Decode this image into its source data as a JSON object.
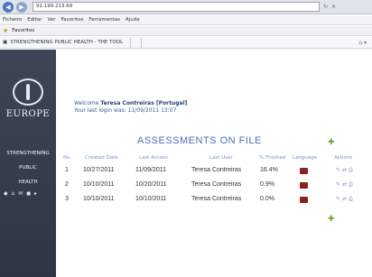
{
  "browser": {
    "address": "91.199.213.69",
    "menu": [
      "Ficheiro",
      "Editar",
      "Ver",
      "Favoritos",
      "Ferramentas",
      "Ajuda"
    ],
    "favorites_label": "Favoritos",
    "tab_label": "STRENGTHENING PUBLIC HEALTH - THE TOOL"
  },
  "sidebar": {
    "region": "EUROPE",
    "menu": [
      "STRENGTHENING",
      "PUBLIC",
      "HEALTH"
    ]
  },
  "header": {
    "welcome_prefix": "Welcome ",
    "user_name": "Teresa Contreiras [Portugal]",
    "last_login": "Your last login was: 11/09/2011 13:07"
  },
  "assessments": {
    "title": "ASSESSMENTS ON FILE",
    "columns": [
      "No.",
      "Created Date",
      "Last Access",
      "Last User",
      "% Finished",
      "Language",
      "Actions"
    ],
    "rows": [
      {
        "no": "1",
        "created": "10/27/2011",
        "last_access": "11/09/2011",
        "last_user": "Teresa Contreiras",
        "finished": "16.4%"
      },
      {
        "no": "2",
        "created": "10/10/2011",
        "last_access": "10/20/2011",
        "last_user": "Teresa Contreiras",
        "finished": "0.9%"
      },
      {
        "no": "3",
        "created": "10/10/2011",
        "last_access": "10/10/2011",
        "last_user": "Teresa Contreiras",
        "finished": "0.0%"
      }
    ]
  },
  "colors": {
    "sidebar": "#3a4150",
    "title": "#4a6fb5",
    "flag": "#8c1f28"
  }
}
